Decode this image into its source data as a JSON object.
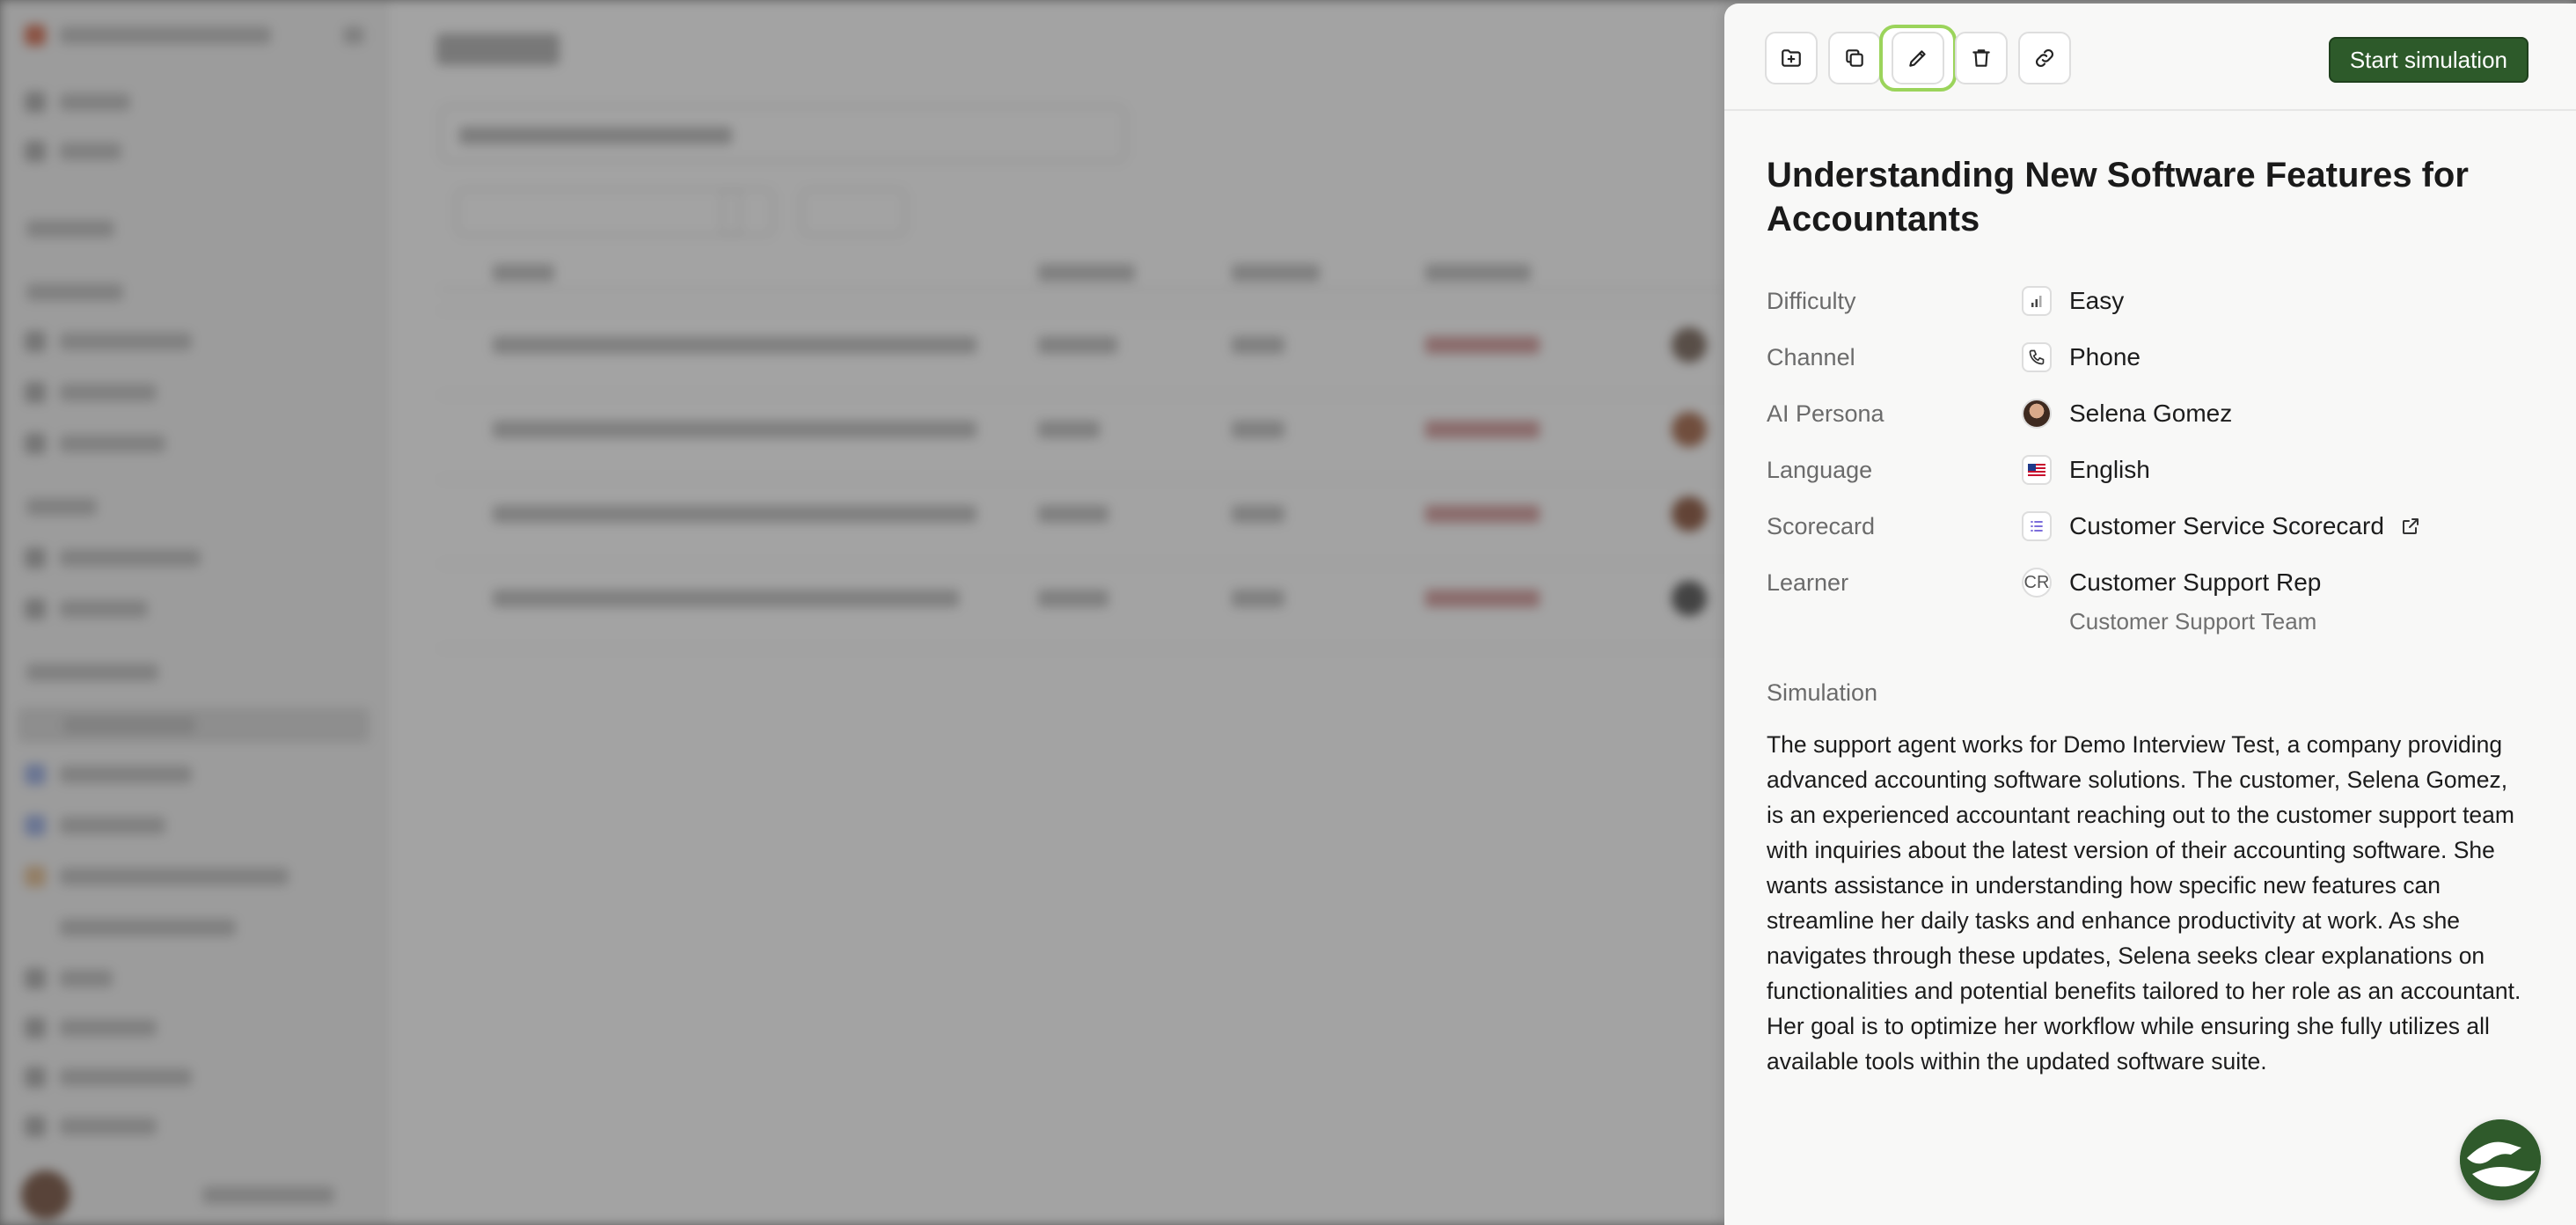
{
  "toolbar": {
    "buttons": [
      {
        "icon": "folder-add-icon"
      },
      {
        "icon": "duplicate-icon"
      },
      {
        "icon": "pencil-icon"
      },
      {
        "icon": "trash-icon"
      },
      {
        "icon": "link-icon"
      }
    ],
    "start_label": "Start simulation"
  },
  "simulation": {
    "title": "Understanding New Software Features for Accountants",
    "properties": {
      "difficulty": {
        "label": "Difficulty",
        "value": "Easy",
        "icon": "bar-chart-icon"
      },
      "channel": {
        "label": "Channel",
        "value": "Phone",
        "icon": "phone-icon"
      },
      "persona": {
        "label": "AI Persona",
        "value": "Selena Gomez",
        "icon": "avatar"
      },
      "language": {
        "label": "Language",
        "value": "English",
        "icon": "us-flag-icon"
      },
      "scorecard": {
        "label": "Scorecard",
        "value": "Customer Service Scorecard",
        "icon": "list-icon"
      },
      "learner": {
        "label": "Learner",
        "value": "Customer Support Rep",
        "sub": "Customer Support Team",
        "initials": "CR"
      }
    },
    "section_label": "Simulation",
    "description": "The support agent works for Demo Interview Test, a company providing advanced accounting software solutions. The customer, Selena Gomez, is an experienced accountant reaching out to the customer support team with inquiries about the latest version of their accounting software. She wants assistance in understanding how specific new features can streamline her daily tasks and enhance productivity at work. As she navigates through these updates, Selena seeks clear explanations on functionalities and potential benefits tailored to her role as an accountant. Her goal is to optimize her workflow while ensuring she fully utilizes all available tools within the updated software suite."
  },
  "colors": {
    "accent": "#2d5a2a",
    "focus_ring": "#9bd45b",
    "panel_bg": "#f8f8f7"
  }
}
